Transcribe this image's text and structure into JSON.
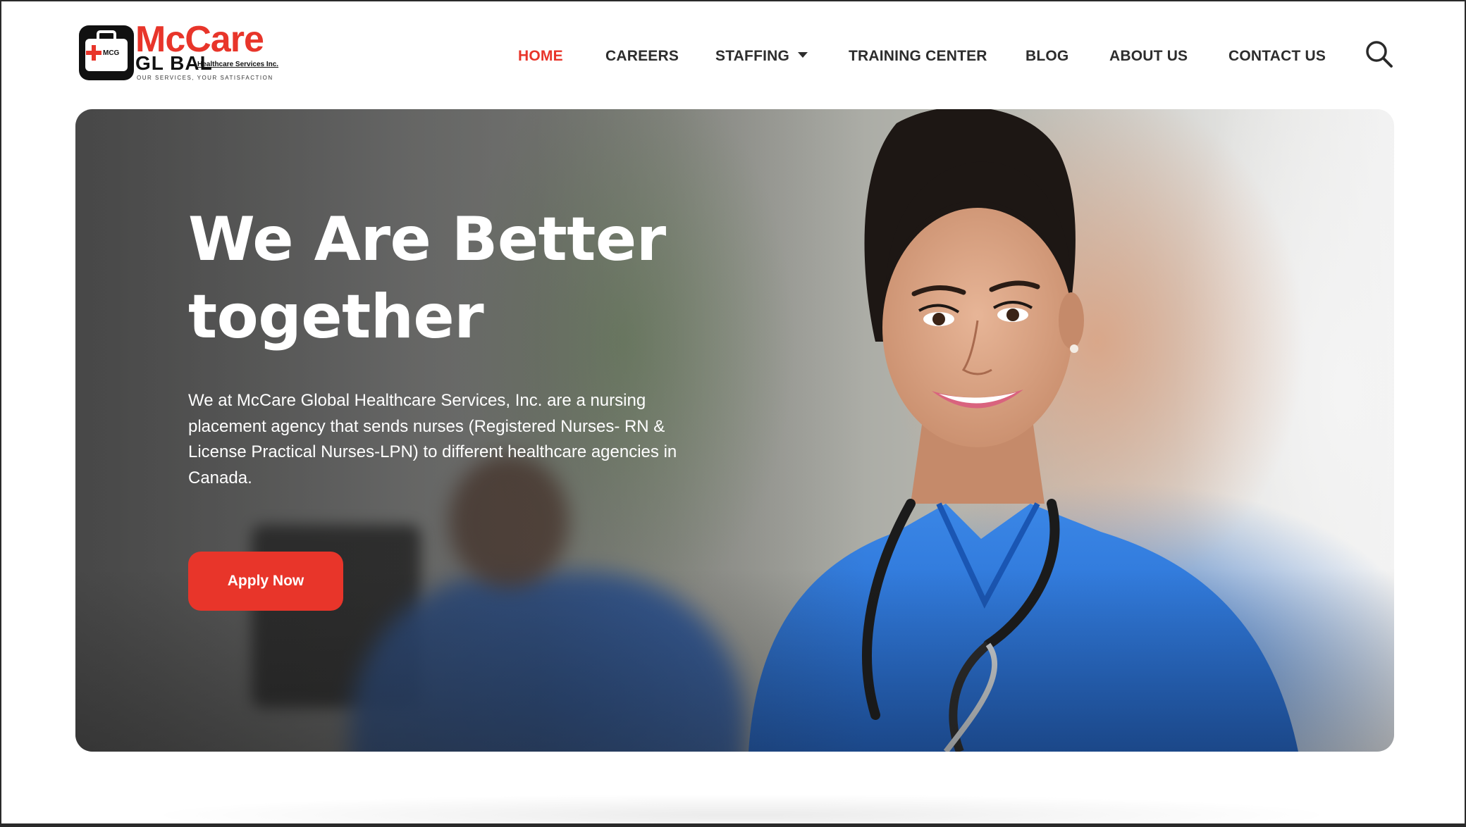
{
  "logo": {
    "name": "McCare",
    "global": "GL BAL",
    "subtitle": "Healthcare Services Inc.",
    "tagline": "OUR SERVICES, YOUR SATISFACTION",
    "badge_text": "MCG",
    "brand_color": "#e8352a"
  },
  "nav": {
    "items": [
      {
        "label": "HOME",
        "active": true
      },
      {
        "label": "CAREERS"
      },
      {
        "label": "STAFFING",
        "has_dropdown": true
      },
      {
        "label": "TRAINING CENTER"
      },
      {
        "label": "BLOG"
      },
      {
        "label": "ABOUT US"
      },
      {
        "label": "CONTACT US"
      }
    ],
    "search_icon": "search-icon"
  },
  "hero": {
    "title_line1": "We Are Better",
    "title_line2": "together",
    "description": "We at McCare Global Healthcare Services, Inc. are a nursing placement agency that sends nurses (Registered Nurses- RN & License Practical Nurses-LPN) to different healthcare agencies in Canada.",
    "cta_label": "Apply Now",
    "cta_color": "#e8352a"
  }
}
